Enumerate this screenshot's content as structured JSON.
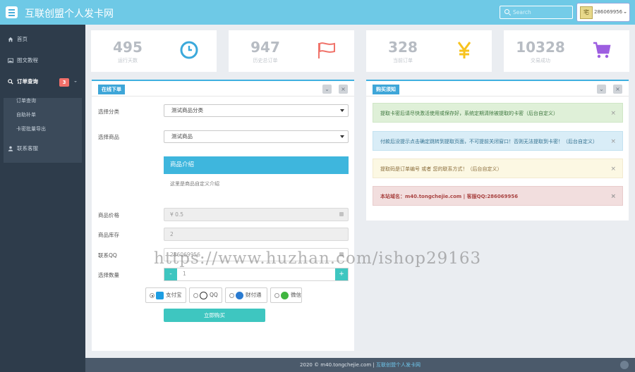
{
  "header": {
    "title": "互联创盟个人发卡网",
    "search_placeholder": "Search",
    "user_name": "286069956",
    "avatar_text": "宅"
  },
  "sidebar": {
    "items": [
      {
        "label": "首页",
        "icon": "home-icon"
      },
      {
        "label": "图文教程",
        "icon": "image-icon"
      },
      {
        "label": "订单查询",
        "icon": "search-icon",
        "badge": "3"
      },
      {
        "label": "联系客服",
        "icon": "user-icon"
      }
    ],
    "subitems": [
      {
        "label": "订单查询"
      },
      {
        "label": "自助补单"
      },
      {
        "label": "卡密批量导出"
      }
    ]
  },
  "stats": [
    {
      "value": "495",
      "label": "运行天数",
      "icon": "clock-icon",
      "color": "#3ba9db"
    },
    {
      "value": "947",
      "label": "历史总订单",
      "icon": "flag-icon",
      "color": "#f0736a"
    },
    {
      "value": "328",
      "label": "当前订单",
      "icon": "yen-icon",
      "color": "#f7c31e"
    },
    {
      "value": "10328",
      "label": "交易成功",
      "icon": "cart-icon",
      "color": "#9d5ee0"
    }
  ],
  "order_panel": {
    "title": "在线下单",
    "category_label": "选择分类",
    "category_value": "测试商品分类",
    "product_label": "选择商品",
    "product_value": "测试商品",
    "intro_title": "商品介绍",
    "intro_text": "这里是商品自定义介绍",
    "price_label": "商品价格",
    "price_value": "¥ 0.5",
    "stock_label": "商品库存",
    "stock_value": "2",
    "qq_label": "联系QQ",
    "qq_value": "286069956",
    "qty_label": "选择数量",
    "qty_value": "1",
    "qty_minus": "-",
    "qty_plus": "+",
    "payments": [
      {
        "label": "支付宝",
        "selected": true,
        "color": "#1d9de2"
      },
      {
        "label": "QQ",
        "selected": false,
        "color": "#222"
      },
      {
        "label": "财付通",
        "selected": false,
        "color": "#2a7bd1"
      },
      {
        "label": "微信",
        "selected": false,
        "color": "#3fb53f"
      }
    ],
    "buy_label": "立即购买"
  },
  "notice_panel": {
    "title": "购买须知",
    "notices": [
      {
        "text": "提取卡密后请尽快激活使用或保存好，系统定期清除被提取的卡密（后台自定义）",
        "bg": "#dff0d8",
        "border": "#cfe6c6",
        "color": "#3c763d"
      },
      {
        "text": "付款后没提示点击确定跳转到提取页面，不可提前关闭窗口！否则无法提取到卡密！（后台自定义）",
        "bg": "#d9edf7",
        "border": "#c3e2f0",
        "color": "#31708f"
      },
      {
        "text": "提取码是订单编号 或者 您的联系方式！（后台自定义）",
        "bg": "#fcf8e3",
        "border": "#f3ead0",
        "color": "#8a6d3b"
      },
      {
        "text": "本站域名：m40.tongchejie.com | 客服QQ:286069956",
        "bg": "#f2dede",
        "border": "#e8cccc",
        "color": "#a94442"
      }
    ]
  },
  "footer": {
    "prefix": "2020 © m40.tongchejie.com | ",
    "link": "互联创盟个人发卡网"
  },
  "watermark": "https://www.huzhan.com/ishop29163"
}
